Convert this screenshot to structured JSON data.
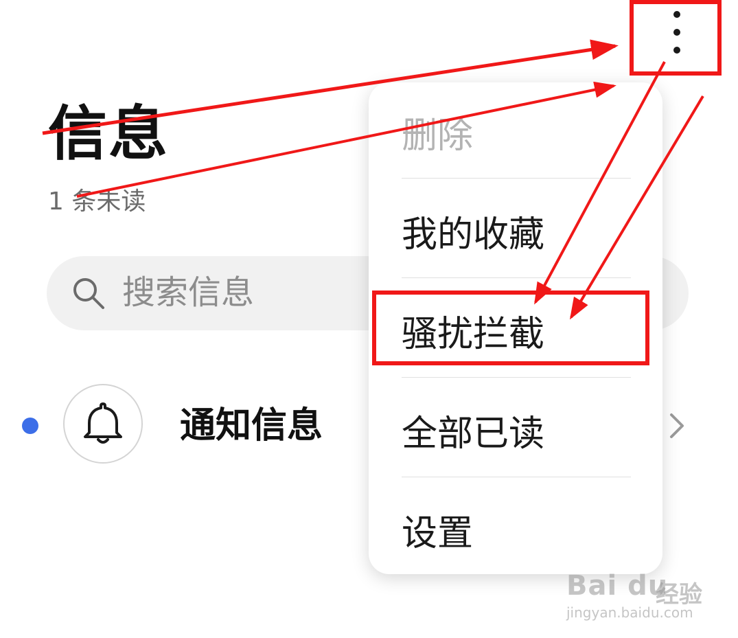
{
  "header": {
    "title": "信息",
    "unread_text": "1 条未读"
  },
  "search": {
    "placeholder": "搜索信息",
    "icon": "search-icon"
  },
  "conversations": [
    {
      "title": "通知信息",
      "icon": "bell-icon",
      "unread": true
    }
  ],
  "overflow_menu": {
    "trigger_icon": "more-vertical-icon",
    "items": [
      {
        "label": "删除",
        "enabled": false
      },
      {
        "label": "我的收藏",
        "enabled": true
      },
      {
        "label": "骚扰拦截",
        "enabled": true,
        "highlighted": true
      },
      {
        "label": "全部已读",
        "enabled": true
      },
      {
        "label": "设置",
        "enabled": true
      }
    ]
  },
  "watermark": {
    "brand": "Bai du",
    "sub": "经验",
    "url": "jingyan.baidu.com"
  },
  "colors": {
    "accent": "#3c6ee8",
    "annotation": "#f01818"
  }
}
